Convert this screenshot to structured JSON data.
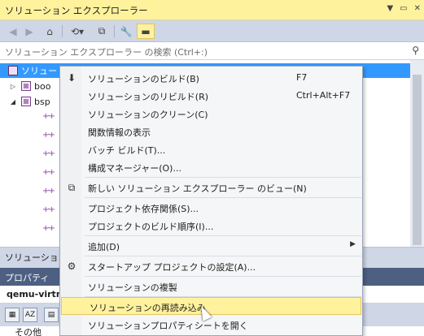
{
  "solution_explorer": {
    "title": "ソリューション エクスプローラー",
    "title_buttons": [
      "▼",
      "▭",
      "✕"
    ],
    "search_placeholder": "ソリューション エクスプローラー の検索 (Ctrl+:)",
    "tree": [
      {
        "label": "ソリュー",
        "selected": true
      },
      {
        "label": "boo"
      },
      {
        "label": "bsp"
      }
    ],
    "bottom_tab": "ソリューション"
  },
  "properties": {
    "title": "プロパティ",
    "object": "qemu-virtm",
    "row": "その他"
  },
  "context_menu": {
    "items": [
      {
        "label": "ソリューションのビルド(B)",
        "shortcut": "F7",
        "icon": "build-icon"
      },
      {
        "label": "ソリューションのリビルド(R)",
        "shortcut": "Ctrl+Alt+F7"
      },
      {
        "label": "ソリューションのクリーン(C)"
      },
      {
        "label": "関数情報の表示"
      },
      {
        "label": "バッチ ビルド(T)..."
      },
      {
        "label": "構成マネージャー(O)..."
      },
      {
        "label": "新しい ソリューション エクスプローラー のビュー(N)",
        "icon": "new-view-icon"
      },
      {
        "label": "プロジェクト依存関係(S)..."
      },
      {
        "label": "プロジェクトのビルド順序(I)..."
      },
      {
        "label": "追加(D)"
      },
      {
        "label": "スタートアップ プロジェクトの設定(A)...",
        "icon": "gear-icon"
      },
      {
        "label": "ソリューションの複製"
      },
      {
        "label": "ソリューションの再読み込み",
        "highlighted": true
      },
      {
        "label": "ソリューションプロパティシートを開く"
      }
    ]
  },
  "colors": {
    "title_bar": "#fff29d",
    "selection": "#3399ff",
    "properties_title": "#4d6082"
  }
}
